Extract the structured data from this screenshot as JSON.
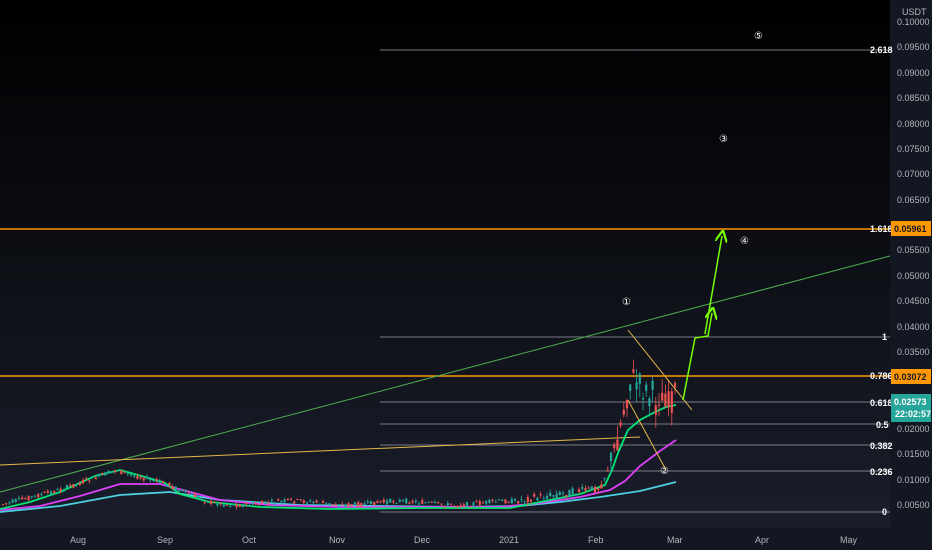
{
  "currency": "USDT",
  "colors": {
    "background": "#131722",
    "accent_orange": "#ff9800",
    "accent_green": "#26a69a",
    "trend_green": "#4caf50",
    "arrow_green": "#76ff03",
    "ma_green": "#00e676",
    "ma_magenta": "#e040fb",
    "ma_cyan": "#4dd0e1",
    "candle_up": "#26a69a",
    "candle_down": "#ef5350"
  },
  "price_axis": {
    "ticks": [
      "0.10000",
      "0.09500",
      "0.09000",
      "0.08500",
      "0.08000",
      "0.07500",
      "0.07000",
      "0.06500",
      "0.05500",
      "0.05000",
      "0.04500",
      "0.04000",
      "0.03500",
      "0.02000",
      "0.01500",
      "0.01000",
      "0.00500"
    ]
  },
  "time_axis": {
    "labels": [
      "Aug",
      "Sep",
      "Oct",
      "Nov",
      "Dec",
      "2021",
      "Feb",
      "Mar",
      "Apr",
      "May"
    ]
  },
  "fib_levels": [
    {
      "label": "2.618",
      "price": 0.0947
    },
    {
      "label": "1.618",
      "price": 0.0596
    },
    {
      "label": "1",
      "price": 0.0385
    },
    {
      "label": "0.786",
      "price": 0.0307
    },
    {
      "label": "0.618",
      "price": 0.0257
    },
    {
      "label": "0.5",
      "price": 0.0213
    },
    {
      "label": "0.382",
      "price": 0.0172
    },
    {
      "label": "0.236",
      "price": 0.012
    },
    {
      "label": "0",
      "price": 0.0035
    }
  ],
  "price_badges": [
    {
      "text": "0.05961",
      "kind": "orange"
    },
    {
      "text": "0.03072",
      "kind": "orange"
    },
    {
      "text": "0.02573",
      "kind": "green"
    }
  ],
  "countdown": "22:02:57",
  "wave_labels": [
    "①",
    "②",
    "③",
    "④",
    "⑤"
  ]
}
